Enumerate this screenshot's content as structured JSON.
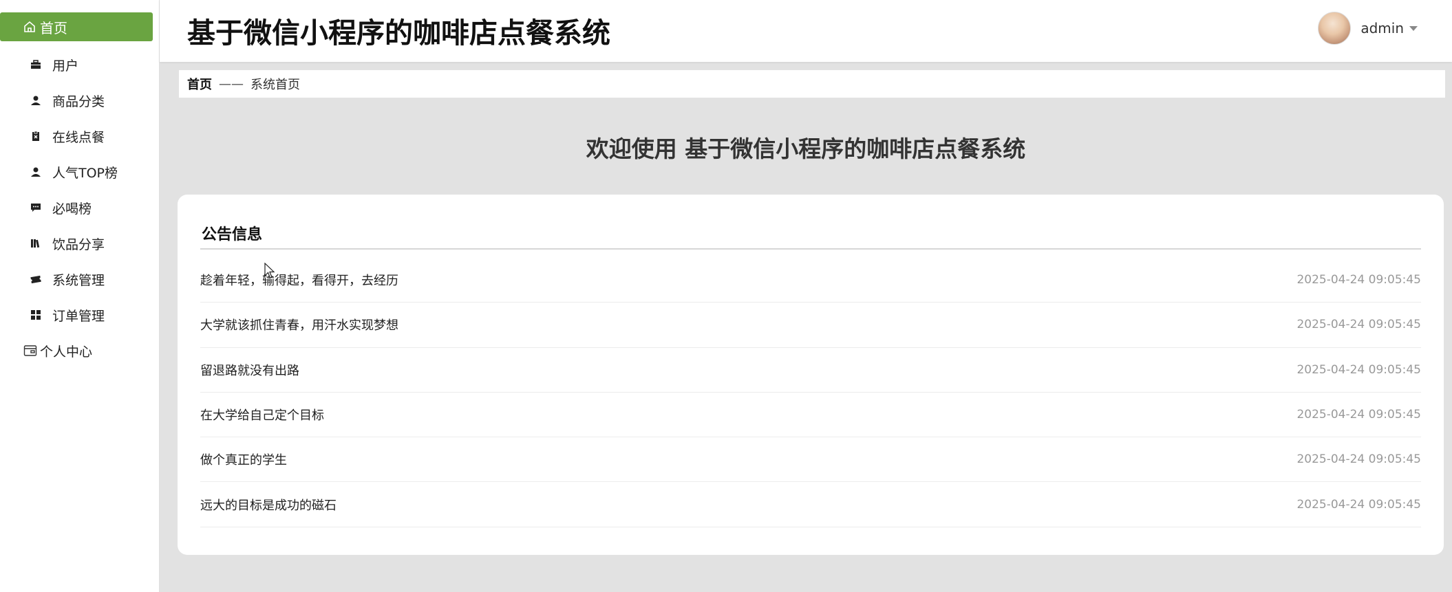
{
  "sidebar": {
    "home": {
      "label": "首页",
      "icon": "home-icon"
    },
    "items": [
      {
        "label": "用户",
        "icon": "briefcase-icon"
      },
      {
        "label": "商品分类",
        "icon": "user-icon"
      },
      {
        "label": "在线点餐",
        "icon": "clipboard-icon"
      },
      {
        "label": "人气TOP榜",
        "icon": "user-icon"
      },
      {
        "label": "必喝榜",
        "icon": "chat-icon"
      },
      {
        "label": "饮品分享",
        "icon": "books-icon"
      },
      {
        "label": "系统管理",
        "icon": "ticket-icon"
      },
      {
        "label": "订单管理",
        "icon": "grid-icon"
      }
    ],
    "personal": {
      "label": "个人中心",
      "icon": "wallet-icon"
    }
  },
  "header": {
    "title": "基于微信小程序的咖啡店点餐系统",
    "username": "admin"
  },
  "breadcrumb": {
    "home": "首页",
    "separator": "——",
    "current": "系统首页"
  },
  "welcome": "欢迎使用 基于微信小程序的咖啡店点餐系统",
  "notice": {
    "title": "公告信息",
    "items": [
      {
        "title": "趁着年轻，输得起，看得开，去经历",
        "date": "2025-04-24 09:05:45"
      },
      {
        "title": "大学就该抓住青春，用汗水实现梦想",
        "date": "2025-04-24 09:05:45"
      },
      {
        "title": "留退路就没有出路",
        "date": "2025-04-24 09:05:45"
      },
      {
        "title": "在大学给自己定个目标",
        "date": "2025-04-24 09:05:45"
      },
      {
        "title": "做个真正的学生",
        "date": "2025-04-24 09:05:45"
      },
      {
        "title": "远大的目标是成功的磁石",
        "date": "2025-04-24 09:05:45"
      }
    ]
  },
  "colors": {
    "accent": "#6aa441",
    "background": "#e2e2e2"
  }
}
